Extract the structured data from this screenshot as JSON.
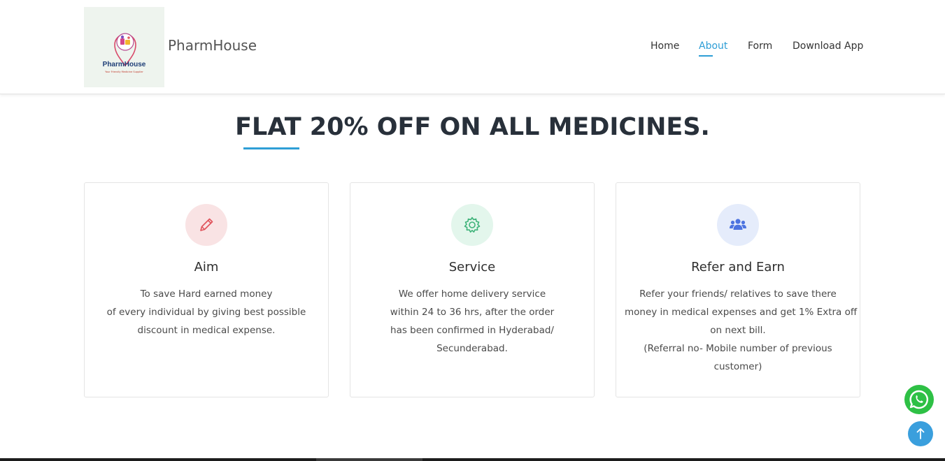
{
  "brand": {
    "logo_word": "PharmHouse",
    "logo_tagline": "Your Friendly Medicine Supplier",
    "name": "PharmHouse"
  },
  "nav": {
    "items": [
      {
        "label": "Home",
        "icon": "",
        "active": false
      },
      {
        "label": "About",
        "icon": "",
        "active": true
      },
      {
        "label": "Form",
        "icon": "",
        "active": false
      },
      {
        "label": "Download App",
        "icon": "",
        "active": false
      }
    ]
  },
  "hero": {
    "headline": "FLAT 20% OFF ON ALL MEDICINES."
  },
  "cards": [
    {
      "title": "Aim",
      "icon": "pencil-icon",
      "icon_color": "#e0525a",
      "icon_bg": "#f9e3e4",
      "lines": [
        "To save Hard earned money",
        "of every individual by giving best possible",
        "discount in medical expense."
      ]
    },
    {
      "title": "Service",
      "icon": "gear-icon",
      "icon_color": "#3fb37a",
      "icon_bg": "#e3f6ec",
      "lines": [
        "We offer home delivery service",
        "within 24 to 36 hrs, after the order",
        "has been confirmed in Hyderabad/",
        "Secunderabad."
      ]
    },
    {
      "title": "Refer and Earn",
      "icon": "users-icon",
      "icon_color": "#4d74e0",
      "icon_bg": "#e5ecfb",
      "lines": [
        "Refer your friends/ relatives to save there",
        "money in medical expenses and get 1% Extra off",
        "on next bill.",
        "(Referral no- Mobile number of previous",
        "customer)"
      ]
    }
  ],
  "floating": {
    "whatsapp_icon": "whatsapp-icon",
    "whatsapp_color": "#2ec045",
    "back_to_top_icon": "arrow-up-icon",
    "back_to_top_color": "#3a9fdd"
  },
  "colors": {
    "accent": "#2e9ed6",
    "heading": "#28303a"
  }
}
